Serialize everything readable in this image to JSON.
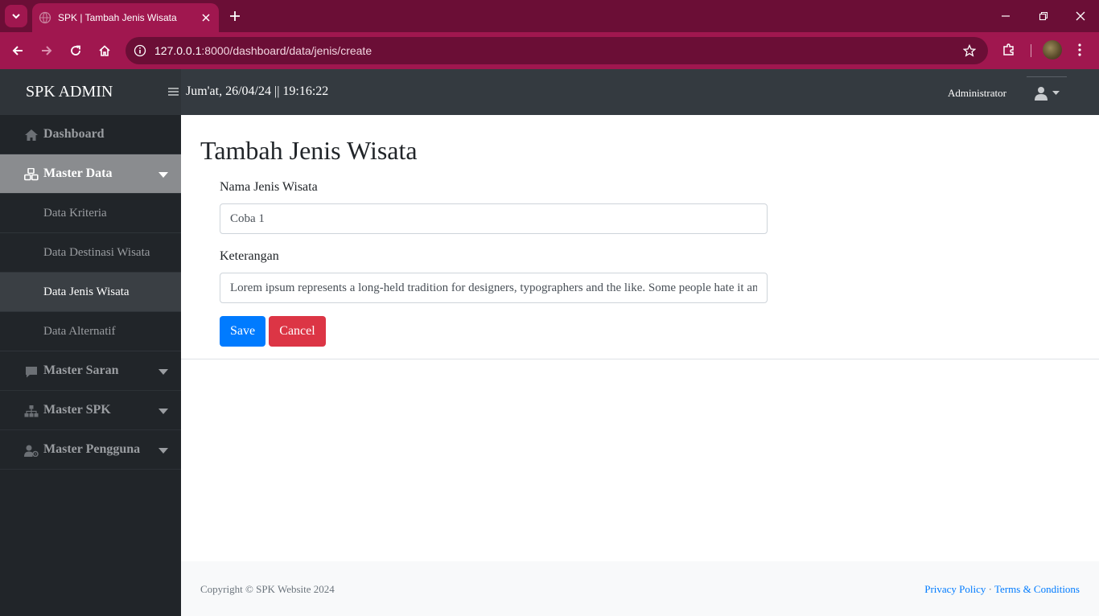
{
  "browser": {
    "tab_title": "SPK | Tambah Jenis Wisata",
    "url_host": "127.0.0.1",
    "url_rest": ":8000/dashboard/data/jenis/create"
  },
  "navbar": {
    "brand": "SPK ADMIN",
    "datetime": "Jum'at, 26/04/24 || 19:16:22",
    "user": "Administrator"
  },
  "sidebar": {
    "items": [
      {
        "label": "Dashboard",
        "icon": "home-icon"
      },
      {
        "label": "Master Data",
        "icon": "cubes-icon",
        "active": true
      },
      {
        "label": "Master Saran",
        "icon": "comment-icon"
      },
      {
        "label": "Master SPK",
        "icon": "sitemap-icon"
      },
      {
        "label": "Master Pengguna",
        "icon": "user-gear-icon"
      }
    ],
    "sub_items": [
      {
        "label": "Data Kriteria"
      },
      {
        "label": "Data Destinasi Wisata"
      },
      {
        "label": "Data Jenis Wisata",
        "current": true
      },
      {
        "label": "Data Alternatif"
      }
    ]
  },
  "main": {
    "title": "Tambah Jenis Wisata",
    "form": {
      "name_label": "Nama Jenis Wisata",
      "name_value": "Coba 1",
      "desc_label": "Keterangan",
      "desc_value": "Lorem ipsum represents a long-held tradition for designers, typographers and the like. Some people hate it and argue for its demise, but others ignore the hate as they create awesome tools to help create filler text."
    },
    "buttons": {
      "save": "Save",
      "cancel": "Cancel"
    }
  },
  "footer": {
    "copyright": "Copyright © SPK Website 2024",
    "privacy": "Privacy Policy",
    "separator": "·",
    "terms": "Terms & Conditions"
  },
  "colors": {
    "browser_frame": "#6b0e36",
    "browser_toolbar": "#a0174f",
    "navbar": "#343a40",
    "sidebar": "#212529",
    "primary": "#007bff",
    "danger": "#dc3545"
  }
}
